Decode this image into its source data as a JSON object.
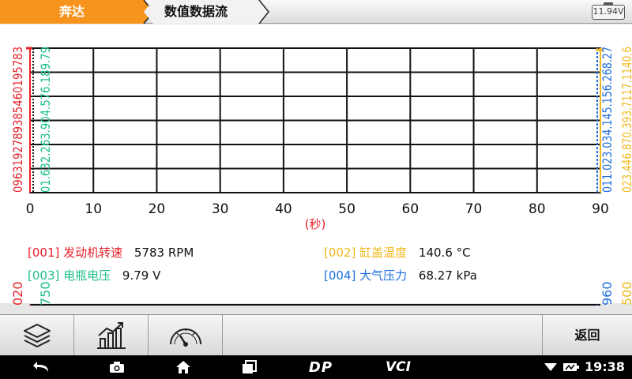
{
  "tabs": {
    "brand": "奔达",
    "stream": "数值数据流"
  },
  "battery": "11.94V",
  "colors": {
    "red": "#e8202a",
    "green": "#1fbf8a",
    "yellow": "#f0b81c",
    "blue": "#1e6ee0",
    "tab_orange": "#f7941d"
  },
  "chart_data": {
    "type": "line",
    "x_ticks": [
      "0",
      "10",
      "20",
      "30",
      "40",
      "50",
      "60",
      "70",
      "80",
      "90"
    ],
    "xlim": [
      0,
      90
    ],
    "xlabel": "(秒)",
    "left_axis_labels": {
      "red": "0963192789385460195783",
      "green": "01.632.263.904.576.189.79"
    },
    "right_axis_labels": {
      "blue": "011.023.034.145.156.268.27",
      "yellow": "023.446.870.393.7117.1140.6"
    },
    "sub_axis_labels": {
      "red": "020",
      "green": "750",
      "blue": "960",
      "yellow": "500"
    },
    "series": [
      {
        "code": "[001]",
        "name": "发动机转速",
        "value": "5783 RPM",
        "color": "red"
      },
      {
        "code": "[002]",
        "name": "缸盖温度",
        "value": "140.6 °C",
        "color": "yellow"
      },
      {
        "code": "[003]",
        "name": "电瓶电压",
        "value": "9.79 V",
        "color": "green"
      },
      {
        "code": "[004]",
        "name": "大气压力",
        "value": "68.27 kPa",
        "color": "blue"
      }
    ]
  },
  "toolbar": {
    "layers_icon": "layers-icon",
    "chart_icon": "bar-chart-icon",
    "gauge_icon": "gauge-icon",
    "back_label": "返回"
  },
  "navbar": {
    "back_icon": "back-arrow-icon",
    "camera_icon": "camera-icon",
    "home_icon": "home-icon",
    "recents_icon": "recents-icon",
    "dp_label": "DP",
    "vci_label": "VCI",
    "time": "19:38"
  }
}
